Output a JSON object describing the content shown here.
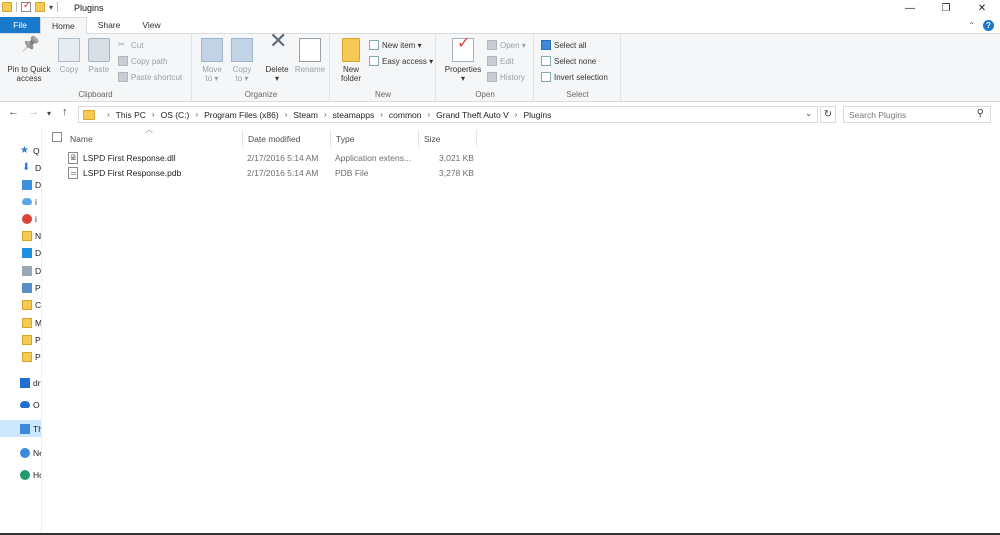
{
  "window": {
    "title": "Plugins",
    "controls": {
      "minimize": "—",
      "maximize": "❐",
      "close": "✕"
    }
  },
  "ribbon_tabs": [
    {
      "label": "File"
    },
    {
      "label": "Home"
    },
    {
      "label": "Share"
    },
    {
      "label": "View"
    }
  ],
  "ribbon": {
    "clipboard": {
      "label": "Clipboard",
      "pin": "Pin to Quick access",
      "pin_line1": "Pin to Quick",
      "pin_line2": "access",
      "copy": "Copy",
      "paste": "Paste",
      "cut": "Cut",
      "copy_path": "Copy path",
      "paste_shortcut": "Paste shortcut"
    },
    "organize": {
      "label": "Organize",
      "move_line1": "Move",
      "move_line2": "to ▾",
      "copy_line1": "Copy",
      "copy_line2": "to ▾",
      "delete_line1": "Delete",
      "delete_line2": "▾",
      "rename": "Rename"
    },
    "new": {
      "label": "New",
      "new_item": "New item ▾",
      "easy_access": "Easy access ▾",
      "folder_line1": "New",
      "folder_line2": "folder"
    },
    "open": {
      "label": "Open",
      "properties_line1": "Properties",
      "properties_line2": "▾",
      "open": "Open ▾",
      "edit": "Edit",
      "history": "History"
    },
    "select": {
      "label": "Select",
      "select_all": "Select all",
      "select_none": "Select none",
      "invert": "Invert selection"
    }
  },
  "address": {
    "breadcrumbs": [
      "This PC",
      "OS (C:)",
      "Program Files (x86)",
      "Steam",
      "steamapps",
      "common",
      "Grand Theft Auto V",
      "Plugins"
    ],
    "search_placeholder": "Search Plugins"
  },
  "nav_pane": [
    {
      "label": "Q",
      "icon": "star-icon",
      "color": "#2a7fd4"
    },
    {
      "label": "D",
      "icon": "download-icon",
      "color": "#2a7fd4"
    },
    {
      "label": "D",
      "icon": "dropbox-icon",
      "color": "#3d8fe0"
    },
    {
      "label": "i",
      "icon": "cloud-icon",
      "color": "#5aa6e6"
    },
    {
      "label": "i",
      "icon": "chrome-icon",
      "color": "#d9433a"
    },
    {
      "label": "N",
      "icon": "folder-icon",
      "color": "#f5c953"
    },
    {
      "label": "D",
      "icon": "desktop-icon",
      "color": "#1e90e0"
    },
    {
      "label": "D",
      "icon": "document-icon",
      "color": "#9aa8b6"
    },
    {
      "label": "P",
      "icon": "pictures-icon",
      "color": "#5b8fc9"
    },
    {
      "label": "C",
      "icon": "folder-icon",
      "color": "#f5c953"
    },
    {
      "label": "M",
      "icon": "folder-icon",
      "color": "#f5c953"
    },
    {
      "label": "P",
      "icon": "folder-icon",
      "color": "#f5c953"
    },
    {
      "label": "P",
      "icon": "folder-icon",
      "color": "#f5c953"
    },
    {
      "label": "dr",
      "icon": "dropbox-icon",
      "color": "#1f6fd1"
    },
    {
      "label": "O",
      "icon": "onedrive-icon",
      "color": "#1f6fd1"
    },
    {
      "label": "Th",
      "icon": "computer-icon",
      "color": "#3b89d8",
      "selected": true
    },
    {
      "label": "Ne",
      "icon": "network-icon",
      "color": "#3b89d8"
    },
    {
      "label": "Ho",
      "icon": "homegroup-icon",
      "color": "#1f9b6d"
    }
  ],
  "columns": [
    {
      "label": "Name"
    },
    {
      "label": "Date modified"
    },
    {
      "label": "Type"
    },
    {
      "label": "Size"
    }
  ],
  "files": [
    {
      "name": "LSPD First Response.dll",
      "date": "2/17/2016 5:14 AM",
      "type": "Application extens...",
      "size": "3,021 KB",
      "icon": "dll-file-icon"
    },
    {
      "name": "LSPD First Response.pdb",
      "date": "2/17/2016 5:14 AM",
      "type": "PDB File",
      "size": "3,278 KB",
      "icon": "pdb-file-icon"
    }
  ]
}
